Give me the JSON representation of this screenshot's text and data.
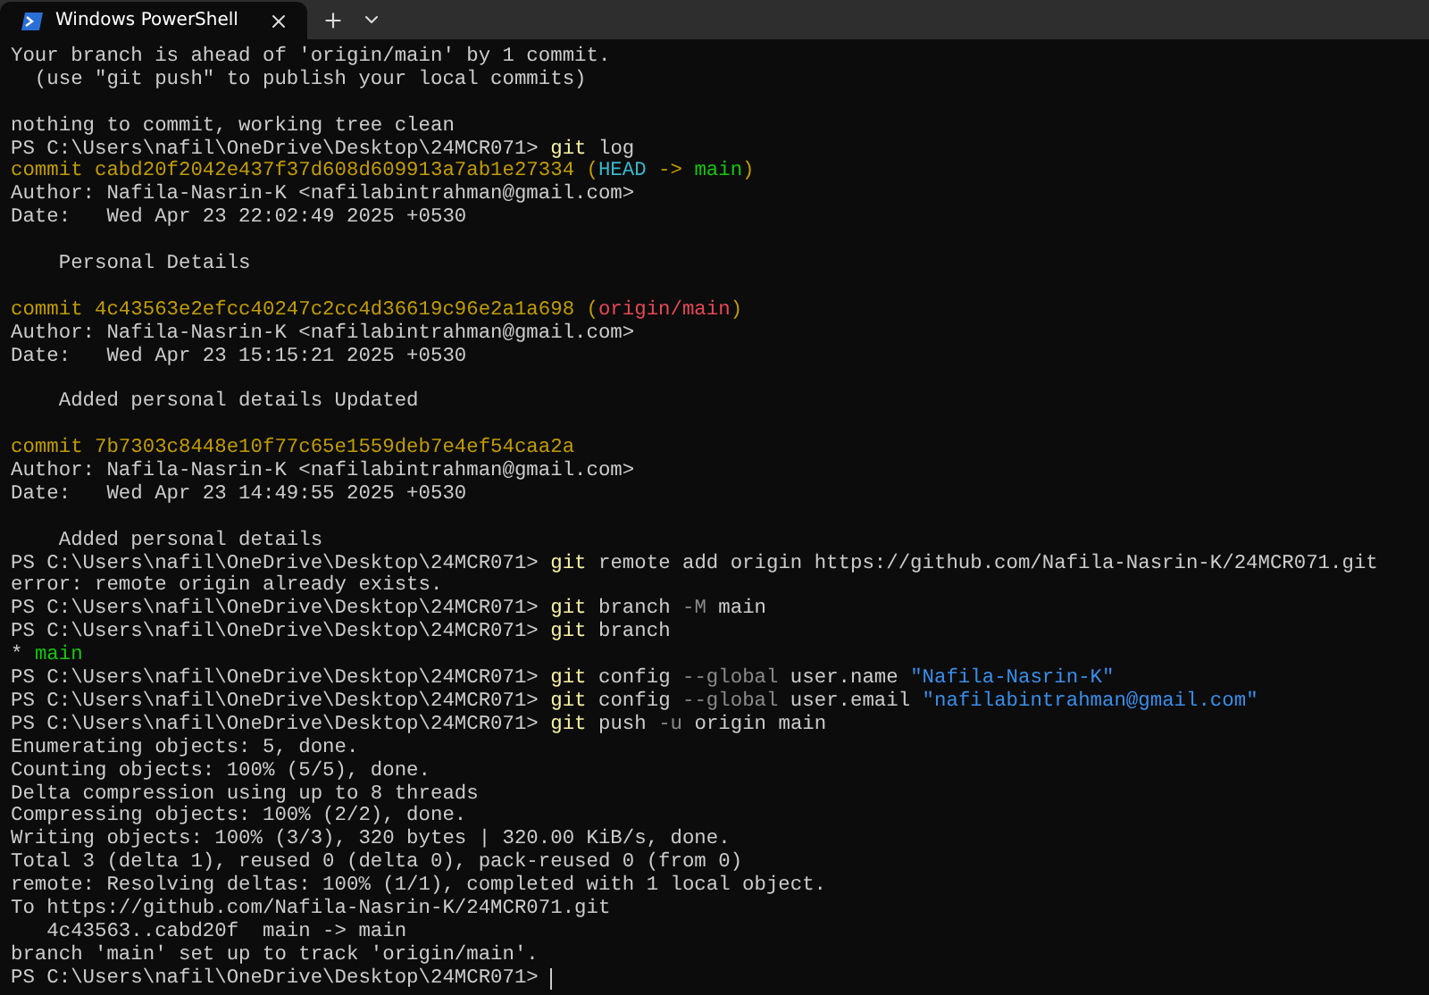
{
  "tabs": [
    {
      "title": "Windows PowerShell",
      "selected": true
    }
  ],
  "terminal": {
    "cursor_visible": true,
    "lines": [
      {
        "kind": "text",
        "segments": [
          {
            "kind": "plain",
            "text": "Your branch is ahead of 'origin/main' by 1 commit."
          }
        ]
      },
      {
        "kind": "text",
        "segments": [
          {
            "kind": "plain",
            "text": "  (use \"git push\" to publish your local commits)"
          }
        ]
      },
      {
        "kind": "blank"
      },
      {
        "kind": "text",
        "segments": [
          {
            "kind": "plain",
            "text": "nothing to commit, working tree clean"
          }
        ]
      },
      {
        "kind": "text",
        "segments": [
          {
            "kind": "prompt",
            "text": "PS C:\\Users\\nafil\\OneDrive\\Desktop\\24MCR071> "
          },
          {
            "kind": "command",
            "text": "git"
          },
          {
            "kind": "arg",
            "text": " log"
          }
        ]
      },
      {
        "kind": "text",
        "segments": [
          {
            "kind": "hash",
            "text": "commit cabd20f2042e437f37d608d609913a7ab1e27334 ("
          },
          {
            "kind": "head",
            "text": "HEAD"
          },
          {
            "kind": "hash",
            "text": " -> "
          },
          {
            "kind": "branch",
            "text": "main"
          },
          {
            "kind": "hash",
            "text": ")"
          }
        ]
      },
      {
        "kind": "text",
        "segments": [
          {
            "kind": "plain",
            "text": "Author: Nafila-Nasrin-K <nafilabintrahman@gmail.com>"
          }
        ]
      },
      {
        "kind": "text",
        "segments": [
          {
            "kind": "plain",
            "text": "Date:   Wed Apr 23 22:02:49 2025 +0530"
          }
        ]
      },
      {
        "kind": "blank"
      },
      {
        "kind": "text",
        "segments": [
          {
            "kind": "plain",
            "text": "    Personal Details"
          }
        ]
      },
      {
        "kind": "blank"
      },
      {
        "kind": "text",
        "segments": [
          {
            "kind": "hash",
            "text": "commit 4c43563e2efcc40247c2cc4d36619c96e2a1a698 ("
          },
          {
            "kind": "remote",
            "text": "origin/main"
          },
          {
            "kind": "hash",
            "text": ")"
          }
        ]
      },
      {
        "kind": "text",
        "segments": [
          {
            "kind": "plain",
            "text": "Author: Nafila-Nasrin-K <nafilabintrahman@gmail.com>"
          }
        ]
      },
      {
        "kind": "text",
        "segments": [
          {
            "kind": "plain",
            "text": "Date:   Wed Apr 23 15:15:21 2025 +0530"
          }
        ]
      },
      {
        "kind": "blank"
      },
      {
        "kind": "text",
        "segments": [
          {
            "kind": "plain",
            "text": "    Added personal details Updated"
          }
        ]
      },
      {
        "kind": "blank"
      },
      {
        "kind": "text",
        "segments": [
          {
            "kind": "hash",
            "text": "commit 7b7303c8448e10f77c65e1559deb7e4ef54caa2a"
          }
        ]
      },
      {
        "kind": "text",
        "segments": [
          {
            "kind": "plain",
            "text": "Author: Nafila-Nasrin-K <nafilabintrahman@gmail.com>"
          }
        ]
      },
      {
        "kind": "text",
        "segments": [
          {
            "kind": "plain",
            "text": "Date:   Wed Apr 23 14:49:55 2025 +0530"
          }
        ]
      },
      {
        "kind": "blank"
      },
      {
        "kind": "text",
        "segments": [
          {
            "kind": "plain",
            "text": "    Added personal details"
          }
        ]
      },
      {
        "kind": "text",
        "segments": [
          {
            "kind": "prompt",
            "text": "PS C:\\Users\\nafil\\OneDrive\\Desktop\\24MCR071> "
          },
          {
            "kind": "command",
            "text": "git"
          },
          {
            "kind": "arg",
            "text": " remote add origin https://github.com/Nafila-Nasrin-K/24MCR071.git"
          }
        ]
      },
      {
        "kind": "text",
        "segments": [
          {
            "kind": "plain",
            "text": "error: remote origin already exists."
          }
        ]
      },
      {
        "kind": "text",
        "segments": [
          {
            "kind": "prompt",
            "text": "PS C:\\Users\\nafil\\OneDrive\\Desktop\\24MCR071> "
          },
          {
            "kind": "command",
            "text": "git"
          },
          {
            "kind": "arg",
            "text": " branch "
          },
          {
            "kind": "flag",
            "text": "-M"
          },
          {
            "kind": "arg",
            "text": " main"
          }
        ]
      },
      {
        "kind": "text",
        "segments": [
          {
            "kind": "prompt",
            "text": "PS C:\\Users\\nafil\\OneDrive\\Desktop\\24MCR071> "
          },
          {
            "kind": "command",
            "text": "git"
          },
          {
            "kind": "arg",
            "text": " branch"
          }
        ]
      },
      {
        "kind": "text",
        "segments": [
          {
            "kind": "plain",
            "text": "* "
          },
          {
            "kind": "branch",
            "text": "main"
          }
        ]
      },
      {
        "kind": "text",
        "segments": [
          {
            "kind": "prompt",
            "text": "PS C:\\Users\\nafil\\OneDrive\\Desktop\\24MCR071> "
          },
          {
            "kind": "command",
            "text": "git"
          },
          {
            "kind": "arg",
            "text": " config "
          },
          {
            "kind": "flag",
            "text": "--global"
          },
          {
            "kind": "arg",
            "text": " user.name "
          },
          {
            "kind": "string",
            "text": "\"Nafila-Nasrin-K\""
          }
        ]
      },
      {
        "kind": "text",
        "segments": [
          {
            "kind": "prompt",
            "text": "PS C:\\Users\\nafil\\OneDrive\\Desktop\\24MCR071> "
          },
          {
            "kind": "command",
            "text": "git"
          },
          {
            "kind": "arg",
            "text": " config "
          },
          {
            "kind": "flag",
            "text": "--global"
          },
          {
            "kind": "arg",
            "text": " user.email "
          },
          {
            "kind": "string",
            "text": "\"nafilabintrahman@gmail.com\""
          }
        ]
      },
      {
        "kind": "text",
        "segments": [
          {
            "kind": "prompt",
            "text": "PS C:\\Users\\nafil\\OneDrive\\Desktop\\24MCR071> "
          },
          {
            "kind": "command",
            "text": "git"
          },
          {
            "kind": "arg",
            "text": " push "
          },
          {
            "kind": "flag",
            "text": "-u"
          },
          {
            "kind": "arg",
            "text": " origin main"
          }
        ]
      },
      {
        "kind": "text",
        "segments": [
          {
            "kind": "plain",
            "text": "Enumerating objects: 5, done."
          }
        ]
      },
      {
        "kind": "text",
        "segments": [
          {
            "kind": "plain",
            "text": "Counting objects: 100% (5/5), done."
          }
        ]
      },
      {
        "kind": "text",
        "segments": [
          {
            "kind": "plain",
            "text": "Delta compression using up to 8 threads"
          }
        ]
      },
      {
        "kind": "text",
        "segments": [
          {
            "kind": "plain",
            "text": "Compressing objects: 100% (2/2), done."
          }
        ]
      },
      {
        "kind": "text",
        "segments": [
          {
            "kind": "plain",
            "text": "Writing objects: 100% (3/3), 320 bytes | 320.00 KiB/s, done."
          }
        ]
      },
      {
        "kind": "text",
        "segments": [
          {
            "kind": "plain",
            "text": "Total 3 (delta 1), reused 0 (delta 0), pack-reused 0 (from 0)"
          }
        ]
      },
      {
        "kind": "text",
        "segments": [
          {
            "kind": "plain",
            "text": "remote: Resolving deltas: 100% (1/1), completed with 1 local object."
          }
        ]
      },
      {
        "kind": "text",
        "segments": [
          {
            "kind": "plain",
            "text": "To https://github.com/Nafila-Nasrin-K/24MCR071.git"
          }
        ]
      },
      {
        "kind": "text",
        "segments": [
          {
            "kind": "plain",
            "text": "   4c43563..cabd20f  main -> main"
          }
        ]
      },
      {
        "kind": "text",
        "segments": [
          {
            "kind": "plain",
            "text": "branch 'main' set up to track 'origin/main'."
          }
        ]
      },
      {
        "kind": "text",
        "segments": [
          {
            "kind": "prompt",
            "text": "PS C:\\Users\\nafil\\OneDrive\\Desktop\\24MCR071> "
          }
        ]
      }
    ]
  }
}
